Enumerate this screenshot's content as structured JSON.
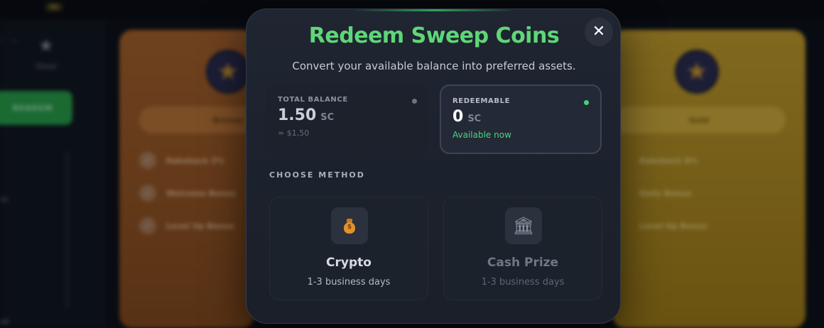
{
  "background": {
    "top_chip": "$$",
    "sidebar": {
      "tier_label": "Silver",
      "redeem_button": "REDEEM",
      "side_text_1": "es",
      "side_text_2": "ad"
    },
    "cards": [
      {
        "tier": "Bronze",
        "perks": [
          "Rakeback 5%",
          "Welcome Bonus",
          "Level Up Bonus"
        ]
      },
      {
        "tier": "Gold",
        "perks": [
          "Rakeback 8%",
          "Daily Bonus",
          "Level Up Bonus"
        ]
      }
    ]
  },
  "modal": {
    "title": "Redeem Sweep Coins",
    "subtitle": "Convert your available balance into preferred assets.",
    "close_symbol": "✕",
    "total_balance": {
      "label": "TOTAL BALANCE",
      "value": "1.50",
      "unit": "SC",
      "approx": "≈ $1,50"
    },
    "redeemable": {
      "label": "REDEEMABLE",
      "value": "0",
      "unit": "SC",
      "status": "Available now"
    },
    "section_label": "CHOOSE METHOD",
    "methods": [
      {
        "name": "Crypto",
        "time": "1-3 business days",
        "icon": "money-bag-icon",
        "glyph": "$"
      },
      {
        "name": "Cash Prize",
        "time": "1-3 business days",
        "icon": "bank-icon",
        "glyph": "🏛"
      }
    ]
  },
  "colors": {
    "accent_green": "#5fd677",
    "status_green": "#4fd37f",
    "modal_bg": "#1f2531",
    "bronze": "#b0662a",
    "gold": "#cca42a"
  }
}
